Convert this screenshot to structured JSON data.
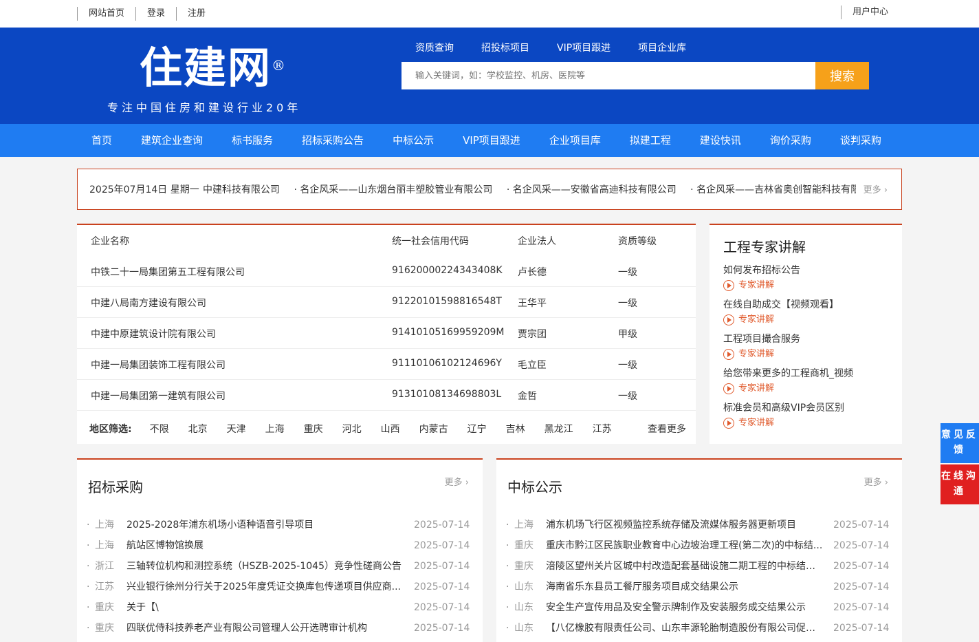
{
  "topbar": {
    "links": [
      "网站首页",
      "登录",
      "注册"
    ],
    "user_center": "用户中心"
  },
  "header": {
    "logo": "住建网",
    "logo_mark": "®",
    "slogan": "专注中国住房和建设行业20年",
    "subnav": [
      "资质查询",
      "招投标项目",
      "VIP项目跟进",
      "项目企业库"
    ],
    "search_placeholder": "输入关键词，如：学校监控、机房、医院等",
    "search_button": "搜索"
  },
  "mainnav": [
    "首页",
    "建筑企业查询",
    "标书服务",
    "招标采购公告",
    "中标公示",
    "VIP项目跟进",
    "企业项目库",
    "拟建工程",
    "建设快讯",
    "询价采购",
    "谈判采购"
  ],
  "ticker": {
    "date": "2025年07月14日 星期一",
    "items": [
      "中建科技有限公司",
      "· 名企风采——山东烟台丽丰塑胶管业有限公司",
      "· 名企风采——安徽省高迪科技有限公司",
      "· 名企风采——吉林省奥创智能科技有限公司"
    ],
    "more": "更多 ›"
  },
  "company": {
    "headers": [
      "企业名称",
      "统一社会信用代码",
      "企业法人",
      "资质等级"
    ],
    "rows": [
      [
        "中铁二十一局集团第五工程有限公司",
        "91620000224343408K",
        "卢长德",
        "一级"
      ],
      [
        "中建八局南方建设有限公司",
        "91220101598816548T",
        "王华平",
        "一级"
      ],
      [
        "中建中原建筑设计院有限公司",
        "91410105169959209M",
        "贾宗团",
        "甲级"
      ],
      [
        "中建一局集团装饰工程有限公司",
        "91110106102124696Y",
        "毛立臣",
        "一级"
      ],
      [
        "中建一局集团第一建筑有限公司",
        "91310108134698803L",
        "金哲",
        "一级"
      ]
    ],
    "region_label": "地区筛选:",
    "regions": [
      "不限",
      "北京",
      "天津",
      "上海",
      "重庆",
      "河北",
      "山西",
      "内蒙古",
      "辽宁",
      "吉林",
      "黑龙江",
      "江苏"
    ],
    "region_more": "查看更多"
  },
  "expert": {
    "title": "工程专家讲解",
    "tag": "专家讲解",
    "items": [
      "如何发布招标公告",
      "在线自助成交【视频观看】",
      "工程项目撮合服务",
      "给您带来更多的工程商机_视频",
      "标准会员和高级VIP会员区别"
    ]
  },
  "bidding": {
    "title": "招标采购",
    "more": "更多 ›",
    "items": [
      {
        "region": "上海",
        "title": "2025-2028年浦东机场小语种语音引导项目",
        "date": "2025-07-14"
      },
      {
        "region": "上海",
        "title": "航站区博物馆换展",
        "date": "2025-07-14"
      },
      {
        "region": "浙江",
        "title": "三轴转位机构和测控系统（HSZB-2025-1045）竞争性磋商公告",
        "date": "2025-07-14"
      },
      {
        "region": "江苏",
        "title": "兴业银行徐州分行关于2025年度凭证交换库包传递项目供应商...",
        "date": "2025-07-14"
      },
      {
        "region": "重庆",
        "title": "关于【\\",
        "date": "2025-07-14"
      },
      {
        "region": "重庆",
        "title": "四联优侍科技养老产业有限公司管理人公开选聘审计机构",
        "date": "2025-07-14"
      }
    ]
  },
  "winning": {
    "title": "中标公示",
    "more": "更多 ›",
    "items": [
      {
        "region": "上海",
        "title": "浦东机场飞行区视频监控系统存储及流媒体服务器更新项目",
        "date": "2025-07-14"
      },
      {
        "region": "重庆",
        "title": "重庆市黔江区民族职业教育中心边坡治理工程(第二次)的中标结...",
        "date": "2025-07-14"
      },
      {
        "region": "重庆",
        "title": "涪陵区望州关片区城中村改造配套基础设施二期工程的中标结果...",
        "date": "2025-07-14"
      },
      {
        "region": "山东",
        "title": "海南省乐东县员工餐厅服务项目成交结果公示",
        "date": "2025-07-14"
      },
      {
        "region": "山东",
        "title": "安全生产宣传用品及安全警示牌制作及安装服务成交结果公示",
        "date": "2025-07-14"
      },
      {
        "region": "山东",
        "title": "【八亿橡胶有限责任公司、山东丰源轮胎制造股份有限公司促进...",
        "date": "2025-07-14"
      }
    ]
  },
  "float": {
    "feedback": "意见反馈",
    "chat": "在线沟通"
  }
}
